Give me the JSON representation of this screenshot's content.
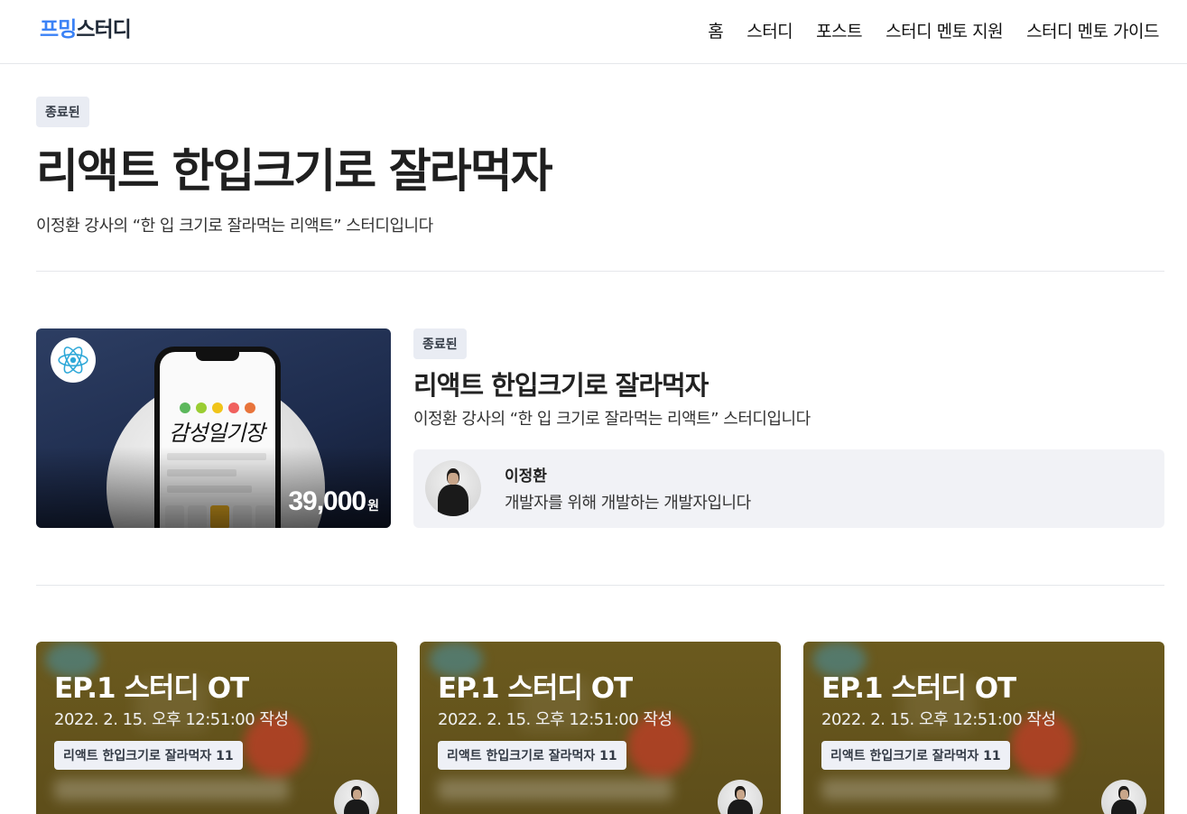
{
  "header": {
    "logo": {
      "part1": "프밍",
      "part2": "스터디"
    },
    "nav": [
      "홈",
      "스터디",
      "포스트",
      "스터디 멘토 지원",
      "스터디 멘토 가이드"
    ]
  },
  "hero": {
    "badge": "종료된",
    "title": "리액트 한입크기로 잘라먹자",
    "description": "이정환 강사의 “한 입 크기로 잘라먹는 리액트” 스터디입니다"
  },
  "study": {
    "thumbnail": {
      "handwriting": "감성일기장",
      "price": "39,000",
      "currency": "원",
      "icon": "react-logo-icon"
    },
    "badge": "종료된",
    "title": "리액트 한입크기로 잘라먹자",
    "description": "이정환 강사의 “한 입 크기로 잘라먹는 리액트” 스터디입니다",
    "mentor": {
      "name": "이정환",
      "bio": "개발자를 위해 개발하는 개발자입니다"
    }
  },
  "posts": [
    {
      "title": "EP.1 스터디 OT",
      "date": "2022. 2. 15. 오후 12:51:00 작성",
      "tag": "리액트 한입크기로 잘라먹자 11"
    },
    {
      "title": "EP.1 스터디 OT",
      "date": "2022. 2. 15. 오후 12:51:00 작성",
      "tag": "리액트 한입크기로 잘라먹자 11"
    },
    {
      "title": "EP.1 스터디 OT",
      "date": "2022. 2. 15. 오후 12:51:00 작성",
      "tag": "리액트 한입크기로 잘라먹자 11"
    }
  ],
  "colors": {
    "brand_blue": "#3b82f6",
    "badge_bg": "#e9ecf3",
    "mentor_bg": "#f1f2f6",
    "post_bg": "#6b5a1e"
  }
}
